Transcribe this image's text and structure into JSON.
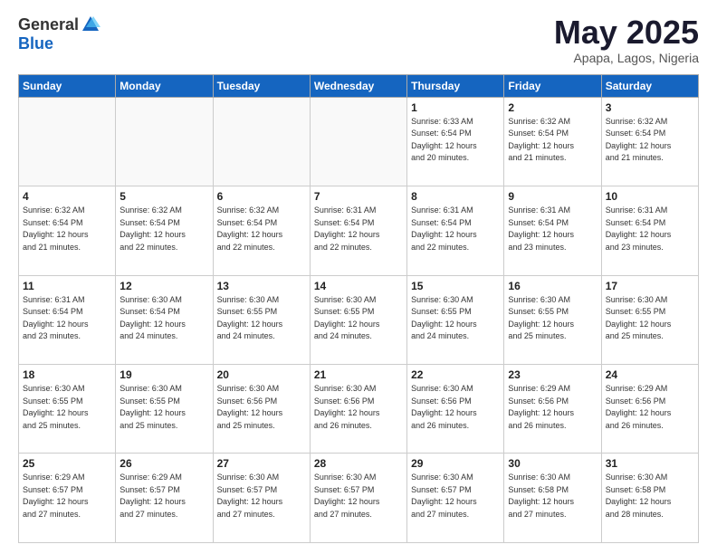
{
  "header": {
    "logo_general": "General",
    "logo_blue": "Blue",
    "month": "May 2025",
    "location": "Apapa, Lagos, Nigeria"
  },
  "weekdays": [
    "Sunday",
    "Monday",
    "Tuesday",
    "Wednesday",
    "Thursday",
    "Friday",
    "Saturday"
  ],
  "weeks": [
    [
      {
        "day": "",
        "info": ""
      },
      {
        "day": "",
        "info": ""
      },
      {
        "day": "",
        "info": ""
      },
      {
        "day": "",
        "info": ""
      },
      {
        "day": "1",
        "info": "Sunrise: 6:33 AM\nSunset: 6:54 PM\nDaylight: 12 hours\nand 20 minutes."
      },
      {
        "day": "2",
        "info": "Sunrise: 6:32 AM\nSunset: 6:54 PM\nDaylight: 12 hours\nand 21 minutes."
      },
      {
        "day": "3",
        "info": "Sunrise: 6:32 AM\nSunset: 6:54 PM\nDaylight: 12 hours\nand 21 minutes."
      }
    ],
    [
      {
        "day": "4",
        "info": "Sunrise: 6:32 AM\nSunset: 6:54 PM\nDaylight: 12 hours\nand 21 minutes."
      },
      {
        "day": "5",
        "info": "Sunrise: 6:32 AM\nSunset: 6:54 PM\nDaylight: 12 hours\nand 22 minutes."
      },
      {
        "day": "6",
        "info": "Sunrise: 6:32 AM\nSunset: 6:54 PM\nDaylight: 12 hours\nand 22 minutes."
      },
      {
        "day": "7",
        "info": "Sunrise: 6:31 AM\nSunset: 6:54 PM\nDaylight: 12 hours\nand 22 minutes."
      },
      {
        "day": "8",
        "info": "Sunrise: 6:31 AM\nSunset: 6:54 PM\nDaylight: 12 hours\nand 22 minutes."
      },
      {
        "day": "9",
        "info": "Sunrise: 6:31 AM\nSunset: 6:54 PM\nDaylight: 12 hours\nand 23 minutes."
      },
      {
        "day": "10",
        "info": "Sunrise: 6:31 AM\nSunset: 6:54 PM\nDaylight: 12 hours\nand 23 minutes."
      }
    ],
    [
      {
        "day": "11",
        "info": "Sunrise: 6:31 AM\nSunset: 6:54 PM\nDaylight: 12 hours\nand 23 minutes."
      },
      {
        "day": "12",
        "info": "Sunrise: 6:30 AM\nSunset: 6:54 PM\nDaylight: 12 hours\nand 24 minutes."
      },
      {
        "day": "13",
        "info": "Sunrise: 6:30 AM\nSunset: 6:55 PM\nDaylight: 12 hours\nand 24 minutes."
      },
      {
        "day": "14",
        "info": "Sunrise: 6:30 AM\nSunset: 6:55 PM\nDaylight: 12 hours\nand 24 minutes."
      },
      {
        "day": "15",
        "info": "Sunrise: 6:30 AM\nSunset: 6:55 PM\nDaylight: 12 hours\nand 24 minutes."
      },
      {
        "day": "16",
        "info": "Sunrise: 6:30 AM\nSunset: 6:55 PM\nDaylight: 12 hours\nand 25 minutes."
      },
      {
        "day": "17",
        "info": "Sunrise: 6:30 AM\nSunset: 6:55 PM\nDaylight: 12 hours\nand 25 minutes."
      }
    ],
    [
      {
        "day": "18",
        "info": "Sunrise: 6:30 AM\nSunset: 6:55 PM\nDaylight: 12 hours\nand 25 minutes."
      },
      {
        "day": "19",
        "info": "Sunrise: 6:30 AM\nSunset: 6:55 PM\nDaylight: 12 hours\nand 25 minutes."
      },
      {
        "day": "20",
        "info": "Sunrise: 6:30 AM\nSunset: 6:56 PM\nDaylight: 12 hours\nand 25 minutes."
      },
      {
        "day": "21",
        "info": "Sunrise: 6:30 AM\nSunset: 6:56 PM\nDaylight: 12 hours\nand 26 minutes."
      },
      {
        "day": "22",
        "info": "Sunrise: 6:30 AM\nSunset: 6:56 PM\nDaylight: 12 hours\nand 26 minutes."
      },
      {
        "day": "23",
        "info": "Sunrise: 6:29 AM\nSunset: 6:56 PM\nDaylight: 12 hours\nand 26 minutes."
      },
      {
        "day": "24",
        "info": "Sunrise: 6:29 AM\nSunset: 6:56 PM\nDaylight: 12 hours\nand 26 minutes."
      }
    ],
    [
      {
        "day": "25",
        "info": "Sunrise: 6:29 AM\nSunset: 6:57 PM\nDaylight: 12 hours\nand 27 minutes."
      },
      {
        "day": "26",
        "info": "Sunrise: 6:29 AM\nSunset: 6:57 PM\nDaylight: 12 hours\nand 27 minutes."
      },
      {
        "day": "27",
        "info": "Sunrise: 6:30 AM\nSunset: 6:57 PM\nDaylight: 12 hours\nand 27 minutes."
      },
      {
        "day": "28",
        "info": "Sunrise: 6:30 AM\nSunset: 6:57 PM\nDaylight: 12 hours\nand 27 minutes."
      },
      {
        "day": "29",
        "info": "Sunrise: 6:30 AM\nSunset: 6:57 PM\nDaylight: 12 hours\nand 27 minutes."
      },
      {
        "day": "30",
        "info": "Sunrise: 6:30 AM\nSunset: 6:58 PM\nDaylight: 12 hours\nand 27 minutes."
      },
      {
        "day": "31",
        "info": "Sunrise: 6:30 AM\nSunset: 6:58 PM\nDaylight: 12 hours\nand 28 minutes."
      }
    ]
  ]
}
